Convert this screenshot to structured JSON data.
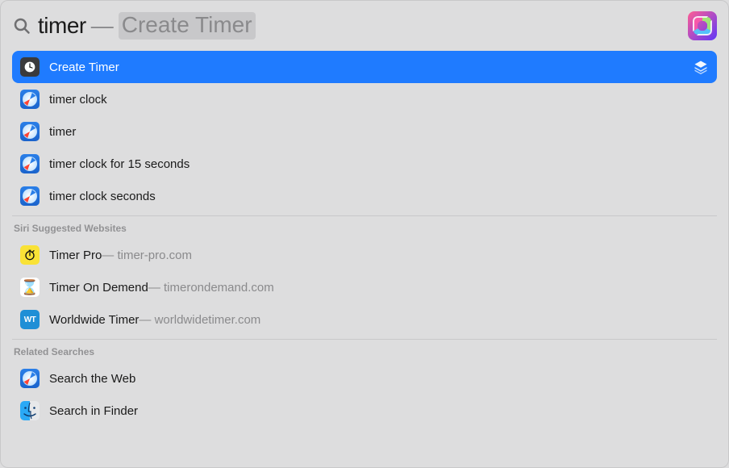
{
  "search": {
    "typed": "timer",
    "dash": "—",
    "completion": "Create Timer"
  },
  "top_results": [
    {
      "id": "create-timer",
      "icon": "clock",
      "label": "Create Timer",
      "selected": true,
      "trailing_icon": "stack"
    },
    {
      "id": "timer-clock",
      "icon": "safari",
      "label": "timer clock"
    },
    {
      "id": "timer",
      "icon": "safari",
      "label": "timer"
    },
    {
      "id": "timer-clock-15s",
      "icon": "safari",
      "label": "timer clock for 15 seconds"
    },
    {
      "id": "timer-clock-seconds",
      "icon": "safari",
      "label": "timer clock seconds"
    }
  ],
  "sections": [
    {
      "title": "Siri Suggested Websites",
      "items": [
        {
          "id": "timer-pro",
          "icon": "timerpro",
          "label": "Timer Pro",
          "sub": " — timer-pro.com"
        },
        {
          "id": "timer-on-demend",
          "icon": "hourglass",
          "label": "Timer On Demend",
          "sub": " — timerondemand.com"
        },
        {
          "id": "worldwide-timer",
          "icon": "wt",
          "label": "Worldwide Timer",
          "sub": " — worldwidetimer.com"
        }
      ]
    },
    {
      "title": "Related Searches",
      "items": [
        {
          "id": "search-web",
          "icon": "safari",
          "label": "Search the Web"
        },
        {
          "id": "search-finder",
          "icon": "finder",
          "label": "Search in Finder"
        }
      ]
    }
  ]
}
